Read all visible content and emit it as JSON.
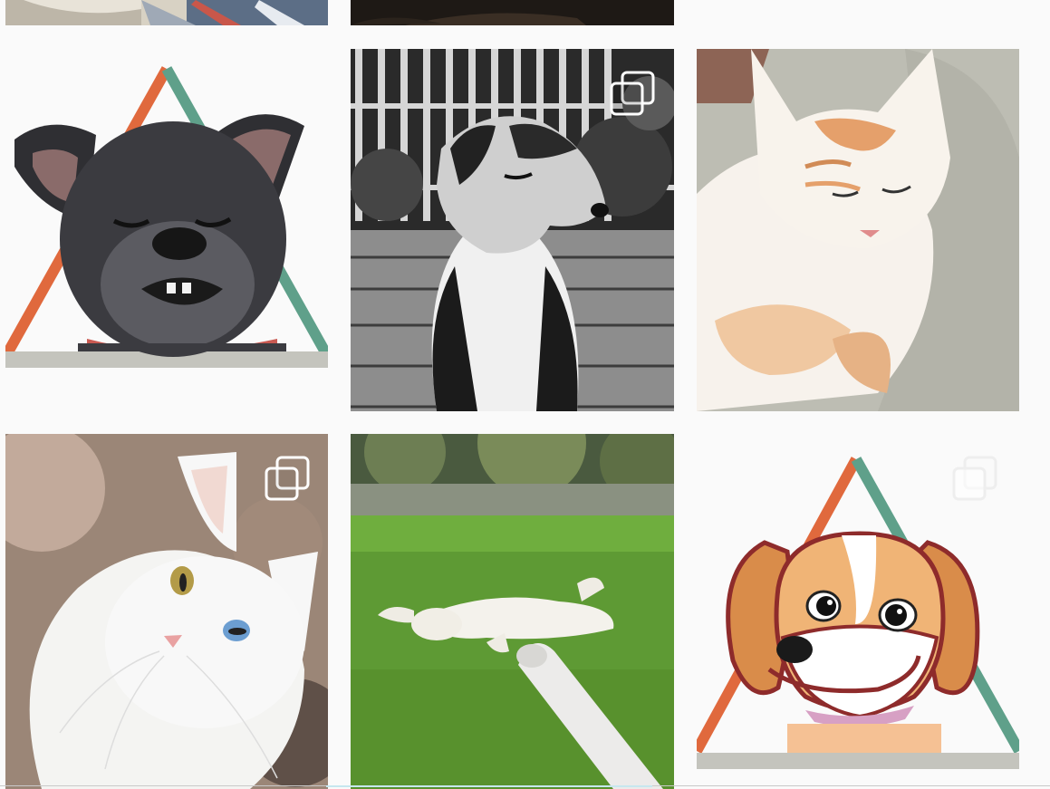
{
  "feed": {
    "posts": [
      {
        "id_label": "cat-partial-top-left",
        "icon": "multiple-photos-icon",
        "multi": false
      },
      {
        "id_label": "dark-partial-top-middle",
        "icon": "multiple-photos-icon",
        "multi": false
      },
      {
        "id_label": "dog-logo-gray",
        "icon": "multiple-photos-icon",
        "multi": false
      },
      {
        "id_label": "dog-bw-fence",
        "icon": "multiple-photos-icon",
        "multi": true
      },
      {
        "id_label": "cat-ginger-sleeping",
        "icon": "multiple-photos-icon",
        "multi": false
      },
      {
        "id_label": "cat-white-heterochromia",
        "icon": "multiple-photos-icon",
        "multi": true
      },
      {
        "id_label": "cat-lawn-rolling",
        "icon": "multiple-photos-icon",
        "multi": false
      },
      {
        "id_label": "beagle-cartoon-logo",
        "icon": "multiple-photos-icon",
        "multi": true
      }
    ]
  },
  "colors": {
    "page_background": "#fafafa",
    "triangle_orange": "#e0693d",
    "triangle_teal": "#5fa08a",
    "base_gray": "#c4c4bd"
  }
}
